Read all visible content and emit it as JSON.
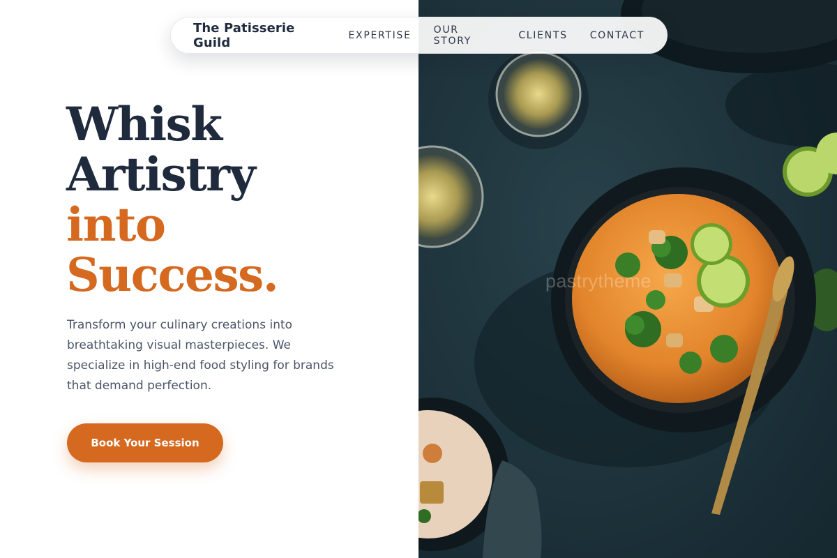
{
  "nav": {
    "brand": "The Patisserie Guild",
    "links": [
      "EXPERTISE",
      "OUR STORY",
      "CLIENTS",
      "CONTACT"
    ]
  },
  "hero": {
    "headline": [
      "Whisk",
      "Artistry",
      "into",
      "Success."
    ],
    "intro": "Transform your culinary creations into breathtaking visual masterpieces. We specialize in high-end food styling for brands that demand perfection.",
    "cta_label": "Book Your Session"
  },
  "photo": {
    "watermark": "pastrytheme",
    "subject": "bowl of curry with broccoli, lime and a gold spoon, glasses of white wine, dark slate table"
  },
  "colors": {
    "navy": "#1f2a3c",
    "accent": "#d5691f",
    "body_text": "#4a5567",
    "table": "#1d3038"
  }
}
